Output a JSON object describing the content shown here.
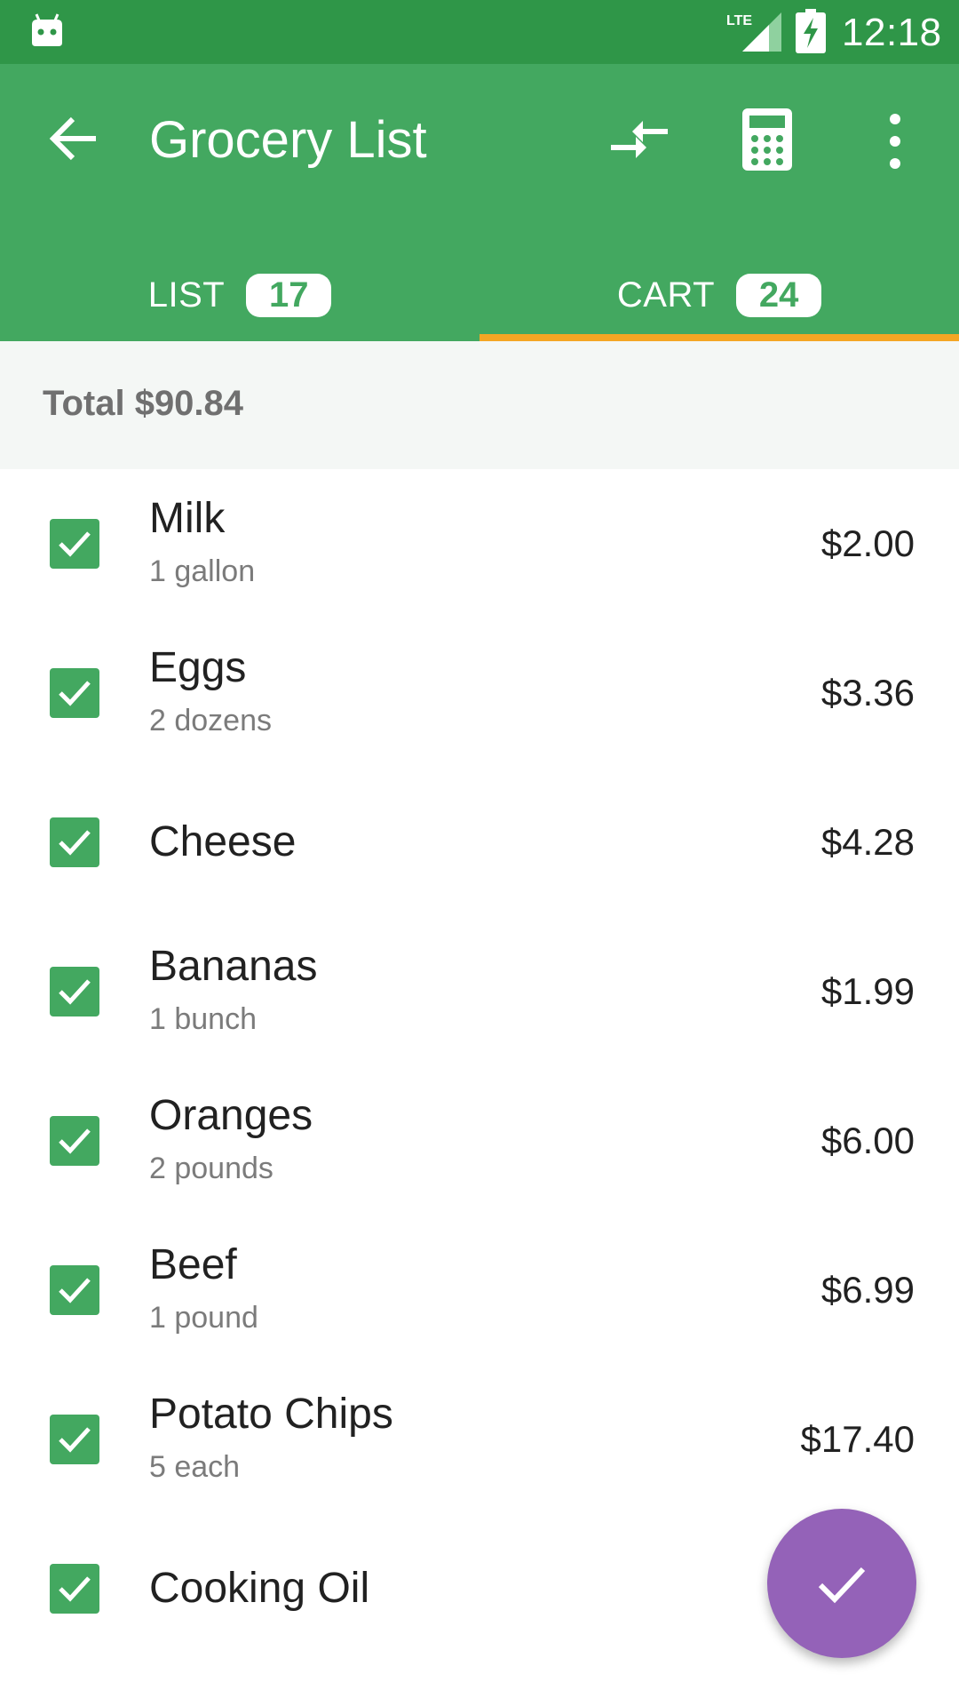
{
  "status_bar": {
    "time": "12:18",
    "network_label": "LTE",
    "icons": [
      "android-icon",
      "lte-signal-icon",
      "battery-charging-icon"
    ]
  },
  "app_bar": {
    "title": "Grocery List",
    "icons": [
      "back-arrow-icon",
      "compare-arrows-icon",
      "calculator-icon",
      "more-vert-icon"
    ]
  },
  "tabs": [
    {
      "label": "LIST",
      "count": "17"
    },
    {
      "label": "CART",
      "count": "24",
      "selected": true
    }
  ],
  "total": {
    "text": "Total $90.84"
  },
  "items": [
    {
      "name": "Milk",
      "quantity": "1 gallon",
      "price": "$2.00",
      "checked": true
    },
    {
      "name": "Eggs",
      "quantity": "2 dozens",
      "price": "$3.36",
      "checked": true
    },
    {
      "name": "Cheese",
      "quantity": "",
      "price": "$4.28",
      "checked": true
    },
    {
      "name": "Bananas",
      "quantity": "1 bunch",
      "price": "$1.99",
      "checked": true
    },
    {
      "name": "Oranges",
      "quantity": "2 pounds",
      "price": "$6.00",
      "checked": true
    },
    {
      "name": "Beef",
      "quantity": "1 pound",
      "price": "$6.99",
      "checked": true
    },
    {
      "name": "Potato Chips",
      "quantity": "5 each",
      "price": "$17.40",
      "checked": true
    },
    {
      "name": "Cooking Oil",
      "quantity": "",
      "price": "",
      "checked": true
    }
  ],
  "fab": {
    "icon": "check-icon"
  },
  "colors": {
    "status_bar": "#2f9648",
    "primary": "#43a860",
    "tab_indicator": "#f4a624",
    "fab": "#9462b8",
    "total_bar_bg": "#f4f7f5"
  }
}
